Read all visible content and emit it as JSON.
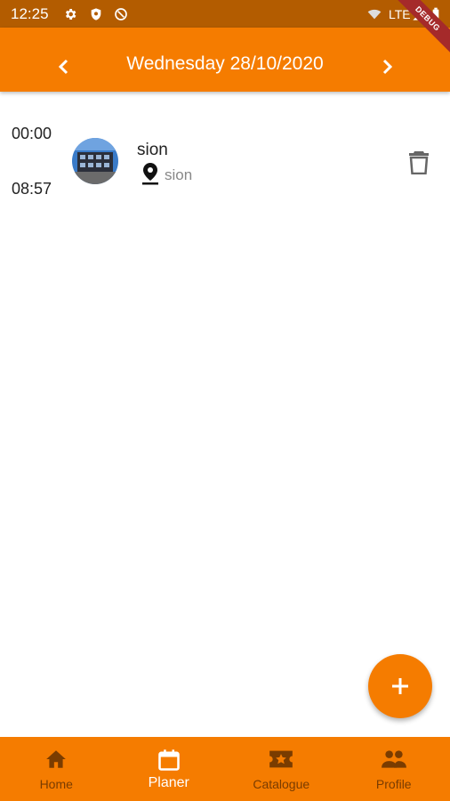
{
  "status_bar": {
    "time": "12:25",
    "network": "LTE",
    "icons": [
      "settings-icon",
      "shield-icon",
      "sync-off-icon",
      "wifi-off-icon",
      "signal-icon",
      "battery-icon"
    ]
  },
  "app_bar": {
    "title": "Wednesday 28/10/2020",
    "prev_icon": "chevron-left-icon",
    "next_icon": "chevron-right-icon",
    "debug_banner": "DEBUG"
  },
  "events": [
    {
      "start": "00:00",
      "end": "08:57",
      "title": "sion",
      "location": "sion",
      "avatar_icon": "building-photo",
      "delete_icon": "trash-icon"
    }
  ],
  "fab": {
    "icon": "plus-icon"
  },
  "bottom_nav": {
    "items": [
      {
        "label": "Home",
        "icon": "home-icon",
        "active": false
      },
      {
        "label": "Planer",
        "icon": "calendar-icon",
        "active": true
      },
      {
        "label": "Catalogue",
        "icon": "ticket-icon",
        "active": false
      },
      {
        "label": "Profile",
        "icon": "people-icon",
        "active": false
      }
    ]
  },
  "colors": {
    "primary": "#f57c00",
    "status_bar": "#b35c00",
    "inactive_nav": "#7a3c00",
    "active_nav": "#ffffff"
  }
}
